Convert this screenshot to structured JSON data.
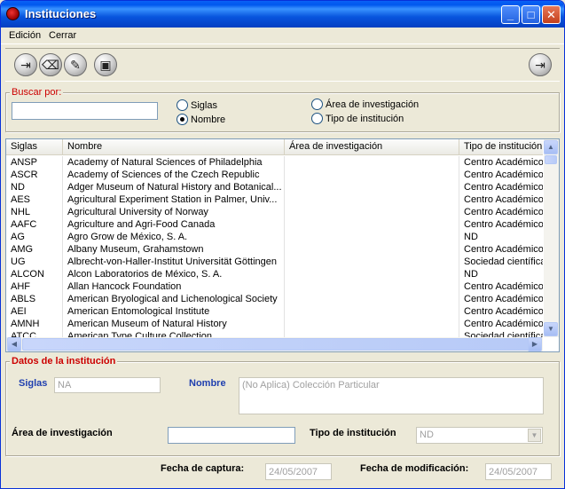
{
  "window": {
    "title": "Instituciones"
  },
  "menu": {
    "items": [
      "Edición",
      "Cerrar"
    ]
  },
  "toolbar": {
    "tools": [
      {
        "name": "new-record-icon",
        "glyph": "⇥"
      },
      {
        "name": "eraser-icon",
        "glyph": "⌫"
      },
      {
        "name": "edit-icon",
        "glyph": "✎"
      },
      {
        "name": "save-icon",
        "glyph": "▣"
      }
    ],
    "exit_glyph": "⇥"
  },
  "search": {
    "legend": "Buscar por:",
    "value": "",
    "options": [
      {
        "label": "Siglas",
        "checked": false
      },
      {
        "label": "Nombre",
        "checked": true
      },
      {
        "label": "Área de investigación",
        "checked": false
      },
      {
        "label": "Tipo de institución",
        "checked": false
      }
    ]
  },
  "grid": {
    "columns": [
      "Siglas",
      "Nombre",
      "Área de investigación",
      "Tipo de institución"
    ],
    "rows": [
      [
        "ANSP",
        "Academy of Natural Sciences of Philadelphia",
        "",
        "Centro Académico"
      ],
      [
        "ASCR",
        "Academy of Sciences of the Czech Republic",
        "",
        "Centro Académico"
      ],
      [
        "ND",
        "Adger Museum of Natural History and Botanical...",
        "",
        "Centro Académico"
      ],
      [
        "AES",
        "Agricultural Experiment Station in Palmer, Univ...",
        "",
        "Centro Académico"
      ],
      [
        "NHL",
        "Agricultural University of Norway",
        "",
        "Centro Académico"
      ],
      [
        "AAFC",
        "Agriculture and Agri-Food Canada",
        "",
        "Centro Académico"
      ],
      [
        "AG",
        "Agro Grow de México, S. A.",
        "",
        "ND"
      ],
      [
        "AMG",
        "Albany Museum, Grahamstown",
        "",
        "Centro Académico"
      ],
      [
        "UG",
        "Albrecht-von-Haller-Institut Universität Göttingen",
        "",
        "Sociedad científica"
      ],
      [
        "ALCON",
        "Alcon Laboratorios de México, S. A.",
        "",
        "ND"
      ],
      [
        "AHF",
        "Allan Hancock Foundation",
        "",
        "Centro Académico"
      ],
      [
        "ABLS",
        "American Bryological and Lichenological Society",
        "",
        "Centro Académico"
      ],
      [
        "AEI",
        "American Entomological Institute",
        "",
        "Centro Académico"
      ],
      [
        "AMNH",
        "American Museum of Natural History",
        "",
        "Centro Académico"
      ],
      [
        "ATCC",
        "American Type Culture Collection",
        "",
        "Sociedad científica"
      ]
    ]
  },
  "details": {
    "legend": "Datos de la institución",
    "siglas_label": "Siglas",
    "siglas_value": "NA",
    "nombre_label": "Nombre",
    "nombre_value": "(No Aplica) Colección Particular",
    "area_label": "Área de investigación",
    "area_value": "",
    "tipo_label": "Tipo de institución",
    "tipo_value": "ND"
  },
  "footer": {
    "captura_label": "Fecha de captura:",
    "captura_value": "24/05/2007",
    "modificacion_label": "Fecha de modificación:",
    "modificacion_value": "24/05/2007"
  }
}
